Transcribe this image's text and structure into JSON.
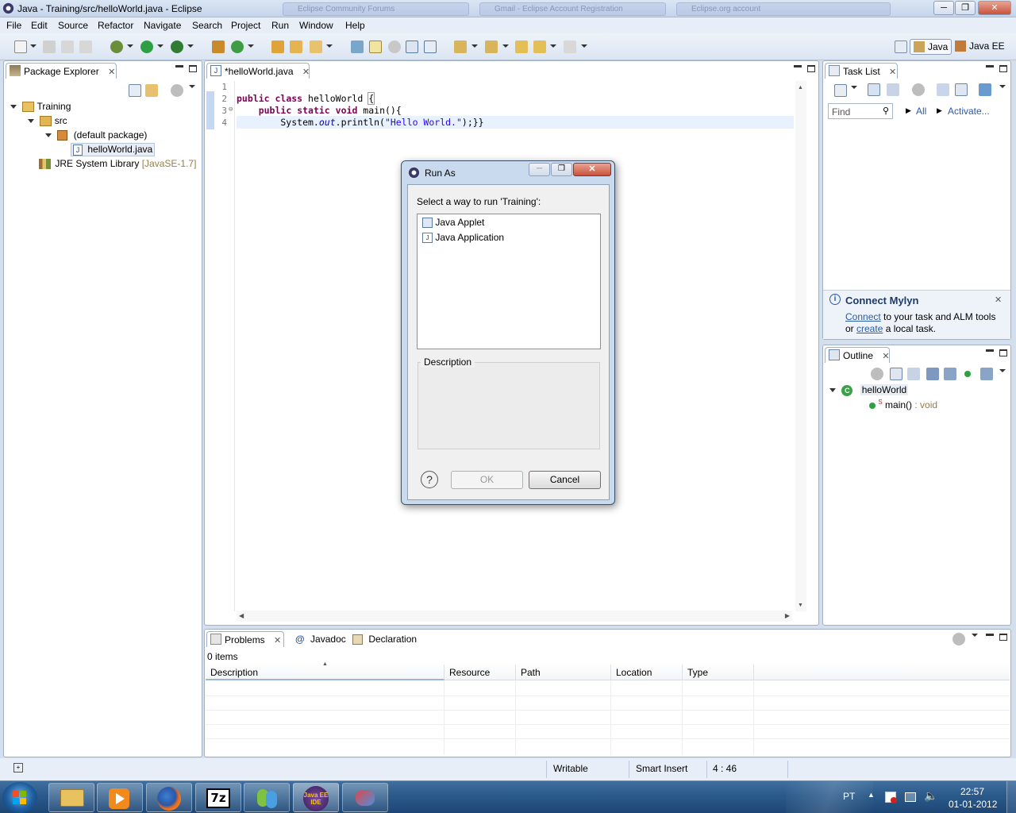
{
  "window": {
    "title": "Java - Training/src/helloWorld.java - Eclipse",
    "bg_tabs": [
      "Eclipse Community Forums",
      "Gmail - Eclipse Account Registration",
      "Eclipse.org account"
    ],
    "controls": [
      "minimize",
      "maximize",
      "close"
    ]
  },
  "menu": [
    "File",
    "Edit",
    "Source",
    "Refactor",
    "Navigate",
    "Search",
    "Project",
    "Run",
    "Window",
    "Help"
  ],
  "perspectives": {
    "java": "Java",
    "javaee": "Java EE"
  },
  "package_explorer": {
    "tab": "Package Explorer",
    "tree": [
      {
        "label": "Training",
        "icon": "project-icon"
      },
      {
        "label": "src",
        "icon": "source-folder-icon"
      },
      {
        "label": "(default package)",
        "icon": "package-icon"
      },
      {
        "label": "helloWorld.java",
        "icon": "java-file-icon"
      },
      {
        "label": "JRE System Library",
        "suffix": "[JavaSE-1.7]",
        "icon": "library-icon"
      }
    ]
  },
  "editor": {
    "tab": "*helloWorld.java",
    "line_numbers": [
      "1",
      "2",
      "3",
      "4"
    ]
  },
  "task_list": {
    "tab": "Task List",
    "find_placeholder": "Find",
    "all_link": "All",
    "activate_link": "Activate...",
    "mylyn_title": "Connect Mylyn",
    "mylyn_connect": "Connect",
    "mylyn_text1": "to your task and ALM tools",
    "mylyn_or": "or",
    "mylyn_create": "create",
    "mylyn_text2": "a local task."
  },
  "outline": {
    "tab": "Outline",
    "class_name": "helloWorld",
    "method": "main()",
    "method_type": ": void"
  },
  "problems": {
    "tabs": [
      "Problems",
      "Javadoc",
      "Declaration"
    ],
    "count": "0 items",
    "columns": [
      "Description",
      "Resource",
      "Path",
      "Location",
      "Type"
    ]
  },
  "dialog": {
    "title": "Run As",
    "prompt": "Select a way to run 'Training':",
    "options": [
      "Java Applet",
      "Java Application"
    ],
    "description_label": "Description",
    "ok": "OK",
    "cancel": "Cancel"
  },
  "status": {
    "writable": "Writable",
    "insert_mode": "Smart Insert",
    "position": "4 : 46"
  },
  "taskbar": {
    "apps": [
      "explorer",
      "media-player",
      "firefox",
      "7-zip",
      "messenger",
      "eclipse-javaee",
      "app"
    ],
    "eclipse_label": "Java EE IDE",
    "sevenzip_label": "7z",
    "language": "PT",
    "time": "22:57",
    "date": "01-01-2012"
  }
}
